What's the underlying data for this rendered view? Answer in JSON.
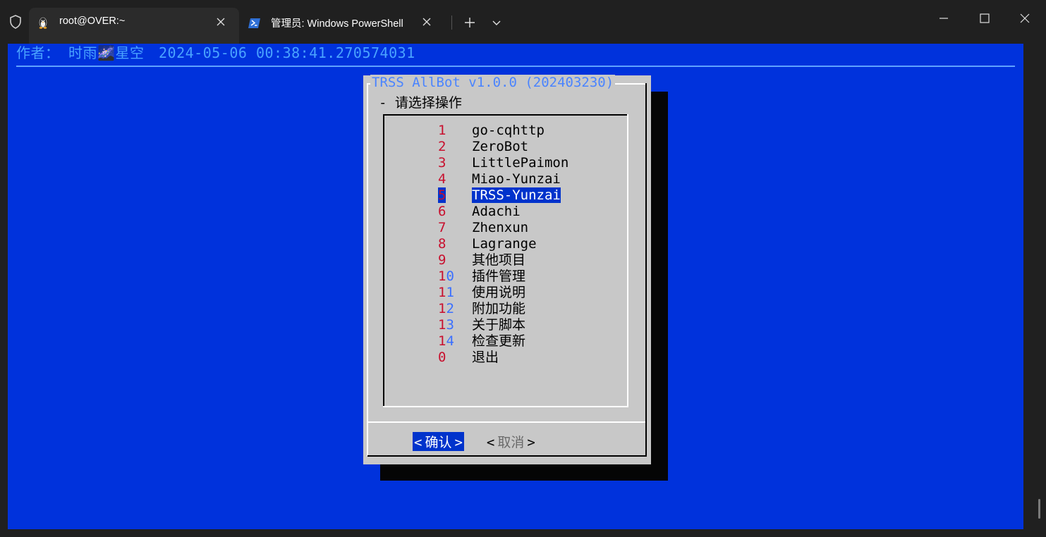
{
  "window": {
    "tabs": [
      {
        "title": "root@OVER:~",
        "icon": "linux-penguin-icon",
        "active": true
      },
      {
        "title": "管理员: Windows PowerShell",
        "icon": "powershell-icon",
        "active": false
      }
    ],
    "new_tab_icon": "plus-icon",
    "dropdown_icon": "chevron-down-icon",
    "controls": [
      "minimize-icon",
      "maximize-icon",
      "close-icon"
    ]
  },
  "terminal": {
    "background": "#0032dc",
    "author_line": "作者： 时雨🌌星空",
    "timestamp": "2024-05-06 00:38:41.270574031"
  },
  "dialog": {
    "title": "TRSS AllBot v1.0.0 (202403230)",
    "prompt": "- 请选择操作",
    "items": [
      {
        "tag_first": "1",
        "tag_rest": "",
        "label": "go-cqhttp"
      },
      {
        "tag_first": "2",
        "tag_rest": "",
        "label": "ZeroBot"
      },
      {
        "tag_first": "3",
        "tag_rest": "",
        "label": "LittlePaimon"
      },
      {
        "tag_first": "4",
        "tag_rest": "",
        "label": "Miao-Yunzai"
      },
      {
        "tag_first": "5",
        "tag_rest": "",
        "label": "TRSS-Yunzai"
      },
      {
        "tag_first": "6",
        "tag_rest": "",
        "label": "Adachi"
      },
      {
        "tag_first": "7",
        "tag_rest": "",
        "label": "Zhenxun"
      },
      {
        "tag_first": "8",
        "tag_rest": "",
        "label": "Lagrange"
      },
      {
        "tag_first": "9",
        "tag_rest": "",
        "label": "其他项目"
      },
      {
        "tag_first": "1",
        "tag_rest": "0",
        "label": "插件管理"
      },
      {
        "tag_first": "1",
        "tag_rest": "1",
        "label": "使用说明"
      },
      {
        "tag_first": "1",
        "tag_rest": "2",
        "label": "附加功能"
      },
      {
        "tag_first": "1",
        "tag_rest": "3",
        "label": "关于脚本"
      },
      {
        "tag_first": "1",
        "tag_rest": "4",
        "label": "检查更新"
      },
      {
        "tag_first": "0",
        "tag_rest": "",
        "label": "退出"
      }
    ],
    "selected_index": 4,
    "ok_button": {
      "left": "<",
      "label": "确认",
      "right": ">"
    },
    "cancel_button": {
      "left": "<",
      "label": "取消",
      "right": ">"
    }
  }
}
